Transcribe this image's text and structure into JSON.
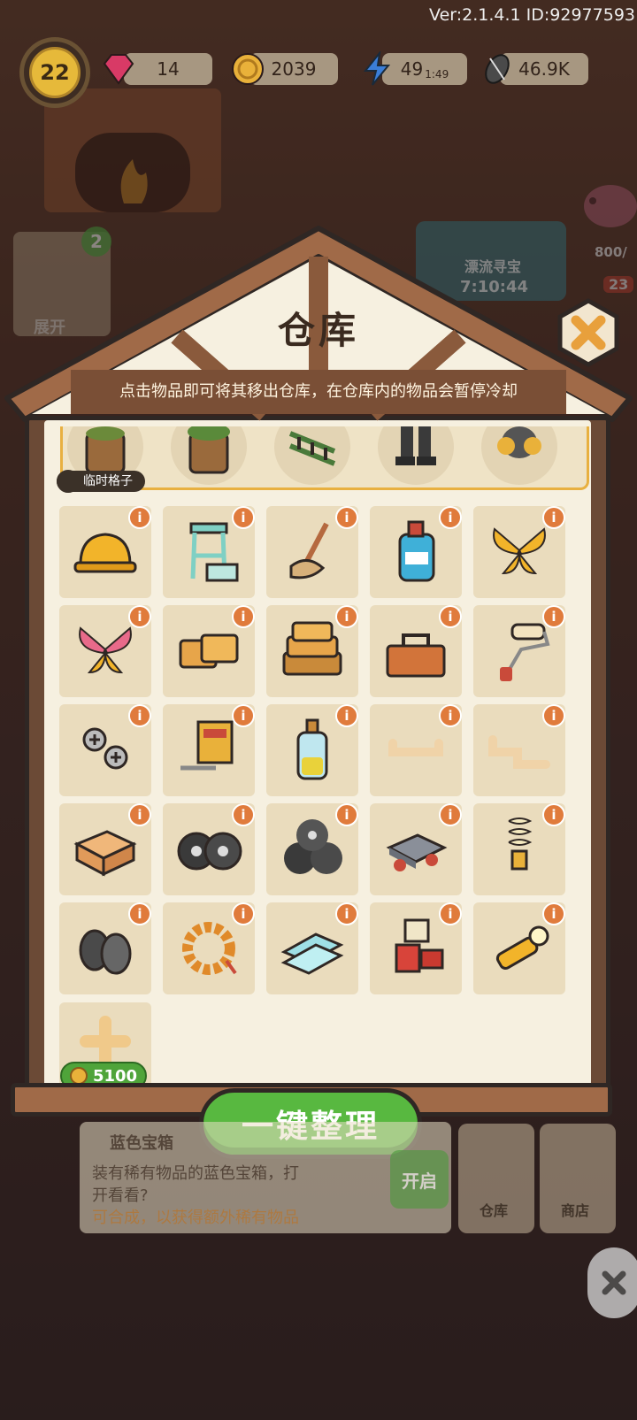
{
  "version_text": "Ver:2.1.4.1 ID:92977593",
  "hud": {
    "level": "22",
    "gems": "14",
    "coins": "2039",
    "energy": "49",
    "energy_timer": "1:49",
    "seeds": "46.9K"
  },
  "background": {
    "expand_label": "展开",
    "expand_badge": "2",
    "event_name": "漂流寻宝",
    "event_timer": "7:10:44",
    "event_progress": "800/",
    "side_badge": "23"
  },
  "warehouse": {
    "title": "仓库",
    "subtitle": "点击物品即可将其移出仓库，在仓库内的物品会暂停冷却",
    "temp_slot_label": "临时格子",
    "temp_items": [
      "bucket-with-leaves-icon",
      "bucket-with-moss-icon",
      "green-ladder-icon",
      "rubber-boots-icon",
      "gas-mask-icon"
    ],
    "info_glyph": "i",
    "items": [
      "hard-hat-icon",
      "step-stool-icon",
      "mop-icon",
      "detergent-bottle-icon",
      "yellow-butterfly-icon",
      "pink-butterfly-icon",
      "cement-bags-icon",
      "cement-pile-icon",
      "toolbox-icon",
      "paint-roller-icon",
      "screws-icon",
      "drill-box-icon",
      "glass-bottle-icon",
      "pipe-icon",
      "pipes-icon",
      "wooden-drawer-icon",
      "two-tires-icon",
      "tire-stack-icon",
      "cart-icon",
      "light-bulb-icon",
      "cable-spools-icon",
      "bead-bracelet-icon",
      "glass-panes-icon",
      "paint-cans-icon",
      "flashlight-icon"
    ],
    "add_slot_price": "5100",
    "sort_button": "一键整理"
  },
  "bottom_panel": {
    "item_title": "蓝色宝箱",
    "item_desc_line1": "装有稀有物品的蓝色宝箱，打",
    "item_desc_line2": "开看看?",
    "item_hint": "可合成，以获得额外稀有物品",
    "open_button": "开启",
    "nav_warehouse": "仓库",
    "nav_shop": "商店"
  },
  "colors": {
    "panel_bg": "#f6f0e0",
    "cell_bg": "#eadcbd",
    "wood": "#a06a48",
    "outline": "#2f2724",
    "info_badge": "#e07b3c",
    "green_button": "#58b840"
  }
}
